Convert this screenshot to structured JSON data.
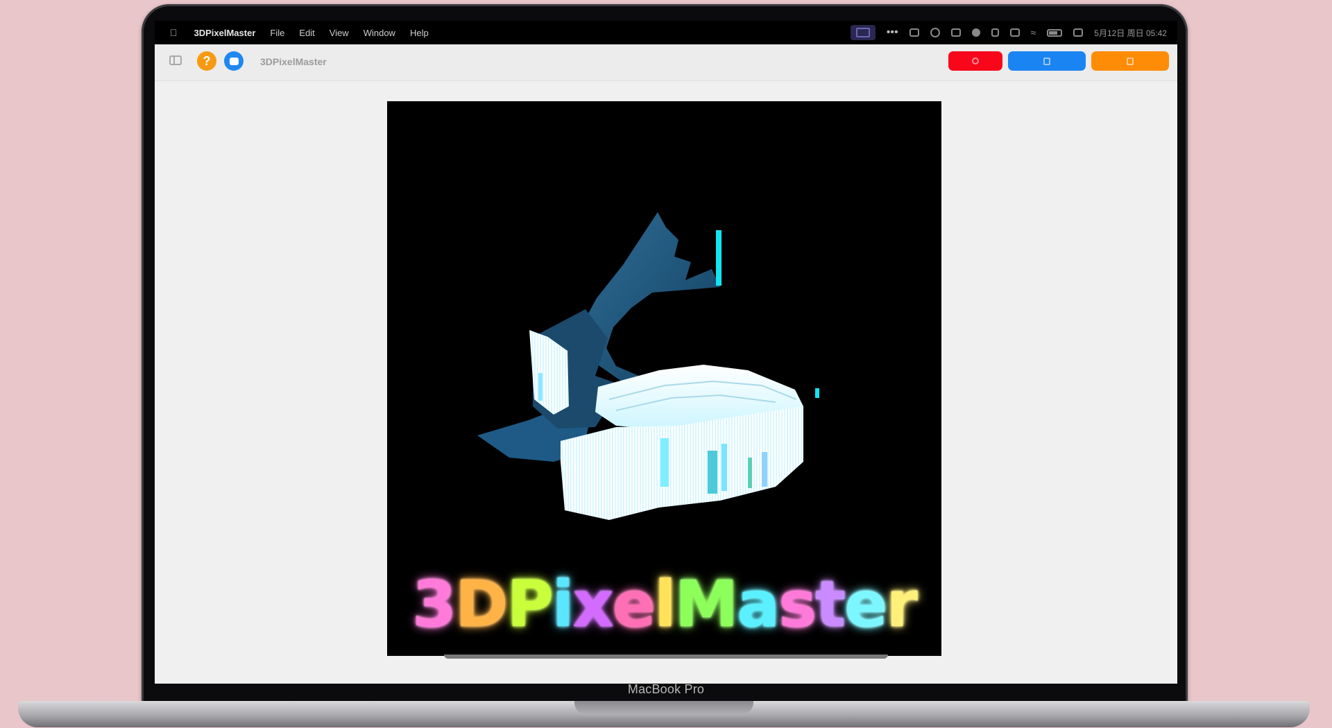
{
  "menubar": {
    "app_name": "3DPixelMaster",
    "menus": [
      "File",
      "Edit",
      "View",
      "Window",
      "Help"
    ],
    "clock": "5月12日 周日  05:42"
  },
  "toolbar": {
    "title": "3DPixelMaster",
    "help_symbol": "?"
  },
  "canvas": {
    "title_letters": [
      "3",
      "D",
      "P",
      "i",
      "x",
      "e",
      "l",
      "M",
      "a",
      "s",
      "t",
      "e",
      "r"
    ],
    "title_colors": [
      "#ff7ad9",
      "#ffb347",
      "#c8ff3a",
      "#5be6ff",
      "#d36bff",
      "#ff6fb5",
      "#ffe25a",
      "#8dff5a",
      "#5bf0ff",
      "#ff7ad9",
      "#c98bff",
      "#7df7ff",
      "#fff07a"
    ]
  },
  "device": {
    "model_label": "MacBook Pro"
  },
  "colors": {
    "help_button": "#f59a12",
    "feedback_button": "#1e88f0",
    "red_button": "#f8071b",
    "blue_button": "#1b84f3",
    "orange_button": "#fe8c06",
    "whale_dark": "#1d4f74",
    "whale_light": "#e9fbff"
  }
}
